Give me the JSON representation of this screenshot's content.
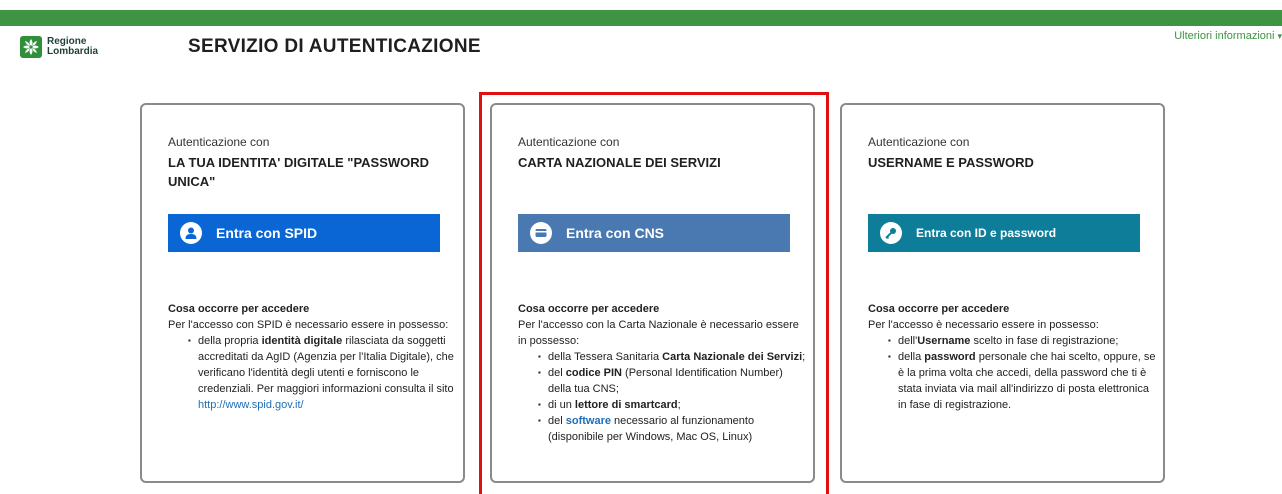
{
  "header": {
    "logo_line1": "Regione",
    "logo_line2": "Lombardia",
    "title": "SERVIZIO DI AUTENTICAZIONE",
    "more_info": "Ulteriori informazioni"
  },
  "colors": {
    "topbar": "#3e9442",
    "spid_button": "#0a66d4",
    "cns_button": "#4a79b1",
    "id_button": "#0d7d99",
    "highlight_border": "#e01010"
  },
  "cards": [
    {
      "subtitle": "Autenticazione con",
      "title": "LA TUA IDENTITA' DIGITALE \"PASSWORD UNICA\"",
      "button": {
        "label": "Entra con SPID",
        "icon": "user-icon"
      },
      "req_title": "Cosa occorre per accedere",
      "req_intro": "Per l'accesso con SPID è necessario essere in possesso:",
      "items": [
        {
          "pre": "della propria ",
          "bold": "identità digitale",
          "post": " rilasciata da soggetti accreditati da AgID (Agenzia per l'Italia Digitale), che verificano l'identità degli utenti e forniscono le credenziali. Per maggiori informazioni consulta il sito",
          "link": "http://www.spid.gov.it/"
        }
      ]
    },
    {
      "subtitle": "Autenticazione con",
      "title": "CARTA NAZIONALE DEI SERVIZI",
      "button": {
        "label": "Entra con CNS",
        "icon": "card-icon"
      },
      "req_title": "Cosa occorre per accedere",
      "req_intro": "Per l'accesso con la Carta Nazionale è necessario essere in possesso:",
      "items": [
        {
          "pre": "della Tessera Sanitaria ",
          "bold": "Carta Nazionale dei Servizi",
          "post": ";"
        },
        {
          "pre": "del ",
          "bold": "codice PIN",
          "post": " (Personal Identification Number) della tua CNS;"
        },
        {
          "pre": "di un ",
          "bold": "lettore di smartcard",
          "post": ";"
        },
        {
          "pre": "del ",
          "link": "software",
          "post": " necessario al funzionamento (disponibile per Windows, Mac OS, Linux)"
        }
      ]
    },
    {
      "subtitle": "Autenticazione con",
      "title": "USERNAME E PASSWORD",
      "button": {
        "label": "Entra con ID e password",
        "icon": "key-icon"
      },
      "req_title": "Cosa occorre per accedere",
      "req_intro": "Per l'accesso è necessario essere in possesso:",
      "items": [
        {
          "pre": "dell'",
          "bold": "Username",
          "post": " scelto in fase di registrazione;"
        },
        {
          "pre": "della ",
          "bold": "password",
          "post": " personale che hai scelto, oppure, se è la prima volta che accedi, della password che ti è stata inviata via mail all'indirizzo di posta elettronica in fase di registrazione."
        }
      ]
    }
  ]
}
